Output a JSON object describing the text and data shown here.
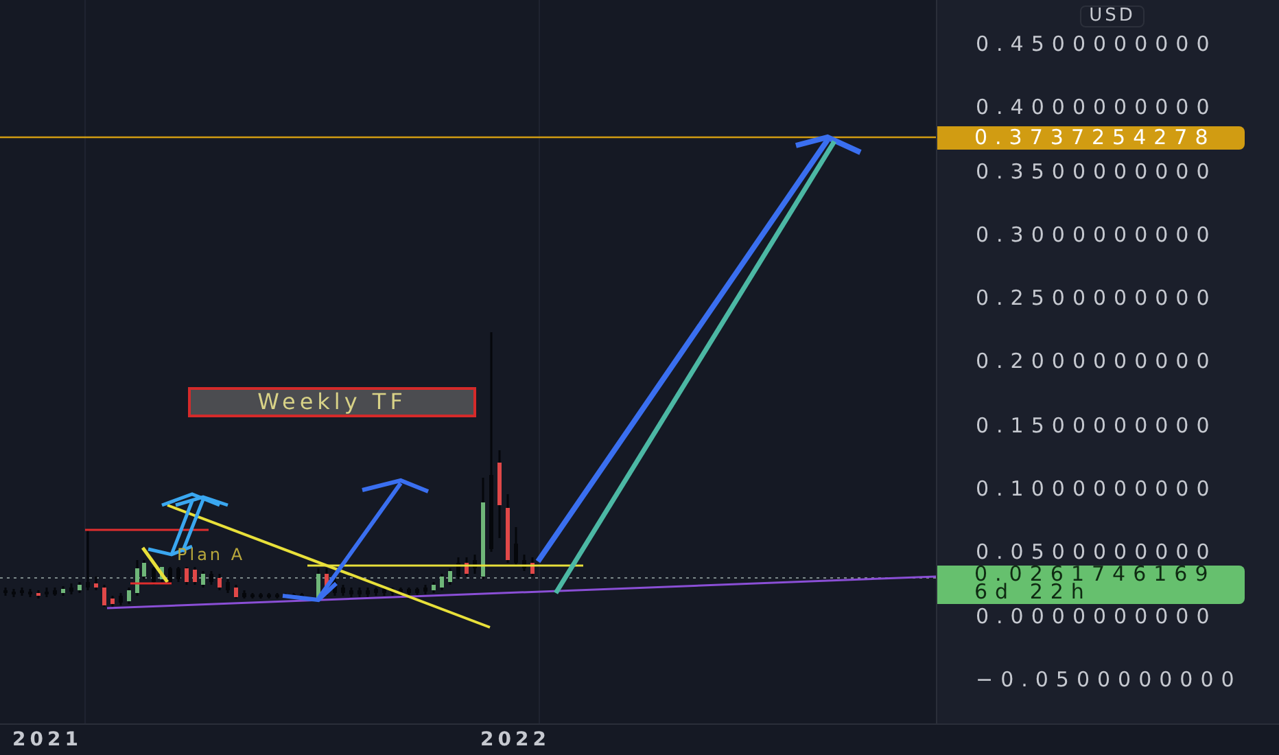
{
  "price_axis": {
    "currency": "USD",
    "labels": [
      "0.4500000000",
      "0.4000000000",
      "0.3500000000",
      "0.3000000000",
      "0.2500000000",
      "0.2000000000",
      "0.1500000000",
      "0.1000000000",
      "0.0500000000",
      "0.0000000000",
      "−0.0500000000"
    ]
  },
  "price_markers": [
    {
      "kind": "target",
      "price": "0.3737254278",
      "color": "#d19c12"
    },
    {
      "kind": "last",
      "price": "0.0261746169",
      "countdown": "6d 22h",
      "color": "#66c06e"
    }
  ],
  "annotations": [
    {
      "kind": "boxed",
      "text": "Weekly TF"
    },
    {
      "kind": "plain",
      "text": "Plan A"
    }
  ],
  "time_axis": [
    "2021",
    "2022"
  ]
}
